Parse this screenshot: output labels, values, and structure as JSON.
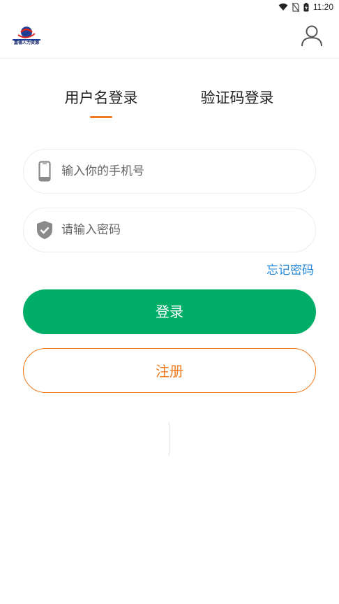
{
  "status_bar": {
    "time": "11:20",
    "icons": [
      "wifi-icon",
      "no-sim-icon",
      "battery-charging-icon"
    ]
  },
  "header": {
    "logo_text": "嘉德人力资源",
    "profile_icon": "user-icon"
  },
  "tabs": [
    {
      "label": "用户名登录",
      "active": true
    },
    {
      "label": "验证码登录",
      "active": false
    }
  ],
  "form": {
    "phone": {
      "value": "",
      "placeholder": "输入你的手机号",
      "icon": "phone-icon"
    },
    "password": {
      "value": "",
      "placeholder": "请输入密码",
      "icon": "shield-check-icon"
    },
    "forgot_label": "忘记密码"
  },
  "buttons": {
    "login_label": "登录",
    "register_label": "注册"
  },
  "colors": {
    "accent_orange": "#f07a1e",
    "login_green": "#00ae67",
    "link_blue": "#2a8ad8"
  }
}
